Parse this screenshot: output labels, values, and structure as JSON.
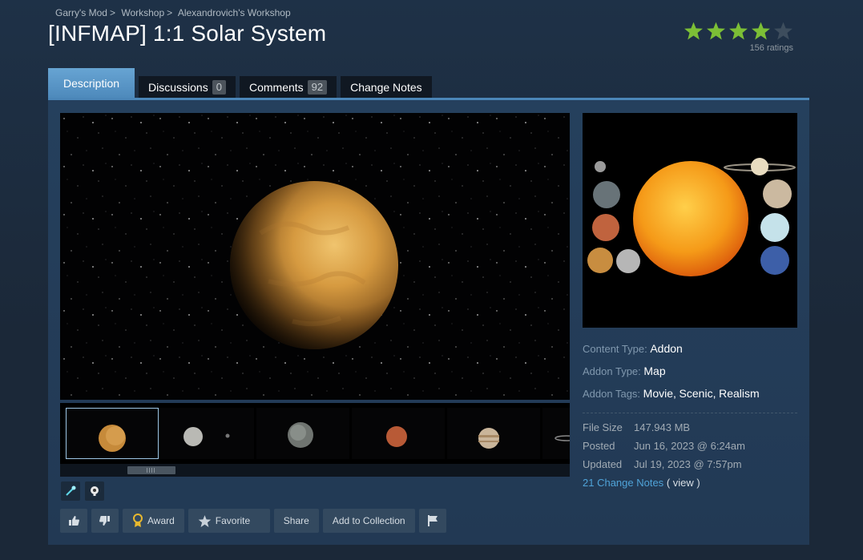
{
  "breadcrumb": {
    "items": [
      "Garry's Mod",
      "Workshop",
      "Alexandrovich's Workshop"
    ],
    "separator": ">"
  },
  "title": "[INFMAP] 1:1 Solar System",
  "rating": {
    "stars_filled": 4,
    "stars_total": 5,
    "count_label": "156 ratings",
    "star_color": "#7cbf36"
  },
  "tabs": [
    {
      "label": "Description",
      "badge": null,
      "active": true
    },
    {
      "label": "Discussions",
      "badge": "0"
    },
    {
      "label": "Comments",
      "badge": "92"
    },
    {
      "label": "Change Notes",
      "badge": null
    }
  ],
  "media": {
    "main_image": "venus-planet",
    "thumbnails": [
      "venus",
      "moon",
      "earth",
      "mars",
      "jupiter",
      "saturn"
    ],
    "selected_thumb": 0
  },
  "details": {
    "content_type_label": "Content Type:",
    "content_type": "Addon",
    "addon_type_label": "Addon Type:",
    "addon_type": "Map",
    "addon_tags_label": "Addon Tags:",
    "addon_tags": [
      "Movie",
      "Scenic",
      "Realism"
    ],
    "file_size_label": "File Size",
    "file_size": "147.943 MB",
    "posted_label": "Posted",
    "posted": "Jun 16, 2023 @ 6:24am",
    "updated_label": "Updated",
    "updated": "Jul 19, 2023 @ 7:57pm",
    "change_notes_link": "21 Change Notes",
    "view_link": "( view )"
  },
  "actions": {
    "award": "Award",
    "favorite": "Favorite",
    "share": "Share",
    "add_to_collection": "Add to Collection"
  },
  "colors": {
    "accent": "#4b86b8",
    "tab_active": "#5f9bcc",
    "link": "#4fa3d8",
    "background": "#1b2838"
  }
}
